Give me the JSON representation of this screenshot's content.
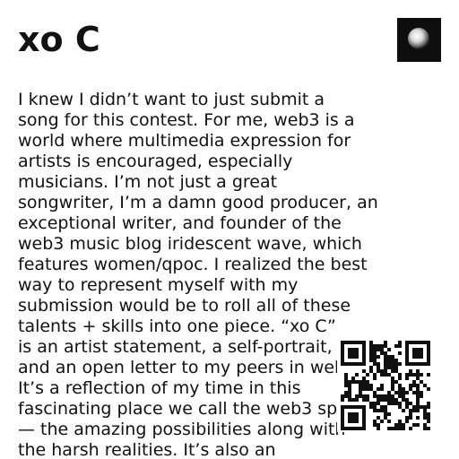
{
  "header": {
    "title": "xo C",
    "thumbnail_icon": "glowing-orb-image"
  },
  "description_lines": [
    "I knew I didn’t want to just submit a",
    "song for this contest. For me, web3 is a",
    "world where multimedia expression for",
    "artists is encouraged, especially",
    "musicians. I’m not just a great",
    "songwriter, I’m a damn good producer, an",
    "exceptional writer, and founder of the",
    "web3 music blog iridescent wave, which",
    "features women/qpoc. I realized the best",
    "way to represent myself with my",
    "submission would be to roll all of these",
    "talents + skills into one piece. “xo C”",
    "is an artist statement, a self-portrait,",
    "and an open letter to my peers in web3.",
    "It’s a reflection of my time in this",
    "fascinating place we call the web3 space",
    "— the amazing possibilities along with",
    "the harsh realities.  It’s also an"
  ],
  "qr": {
    "icon": "qr-code-icon",
    "fg": "#111111",
    "bg": "#ffffff"
  },
  "colors": {
    "text": "#111111",
    "background": "#ffffff",
    "thumbnail_bg": "#101010"
  }
}
